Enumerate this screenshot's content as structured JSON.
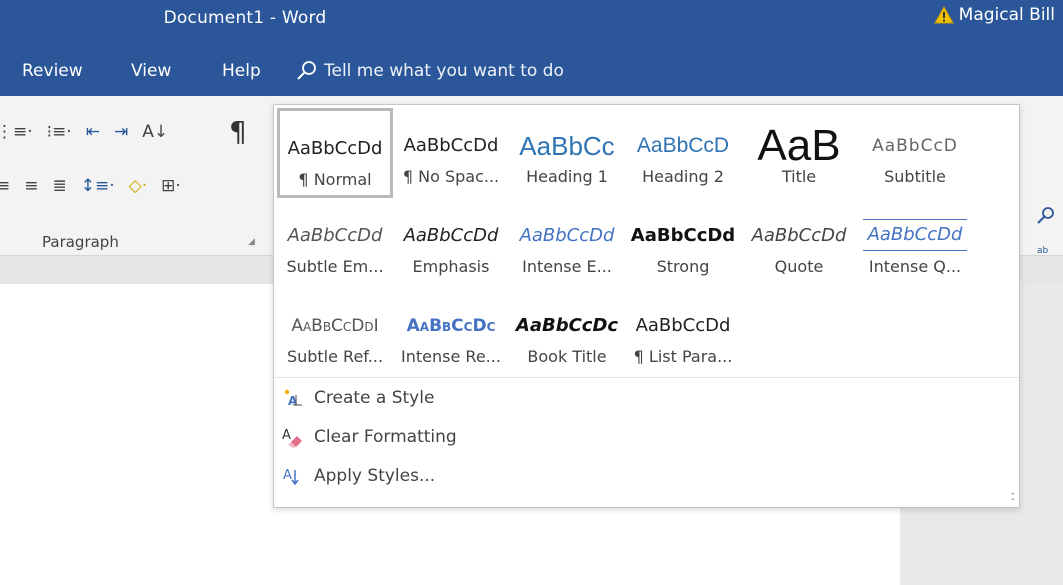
{
  "window": {
    "doc_title": "Document1  -  Word",
    "user_name": "Magical Bill"
  },
  "menu": {
    "tabs": [
      "Review",
      "View",
      "Help"
    ],
    "tell_me": "Tell me what you want to do"
  },
  "ribbon": {
    "paragraph_group_label": "Paragraph"
  },
  "styles": {
    "row1": [
      {
        "preview": "AaBbCcDd",
        "name": "¶ Normal"
      },
      {
        "preview": "AaBbCcDd",
        "name": "¶ No Spac..."
      },
      {
        "preview": "AaBbCc",
        "name": "Heading 1"
      },
      {
        "preview": "AaBbCcD",
        "name": "Heading 2"
      },
      {
        "preview": "AaB",
        "name": "Title"
      },
      {
        "preview": "AaBbCcD",
        "name": "Subtitle"
      }
    ],
    "row2": [
      {
        "preview": "AaBbCcDd",
        "name": "Subtle Em..."
      },
      {
        "preview": "AaBbCcDd",
        "name": "Emphasis"
      },
      {
        "preview": "AaBbCcDd",
        "name": "Intense E..."
      },
      {
        "preview": "AaBbCcDd",
        "name": "Strong"
      },
      {
        "preview": "AaBbCcDd",
        "name": "Quote"
      },
      {
        "preview": "AaBbCcDd",
        "name": "Intense Q..."
      }
    ],
    "row3": [
      {
        "preview": "AaBbCcDdI",
        "name": "Subtle Ref..."
      },
      {
        "preview": "AaBbCcDc",
        "name": "Intense Re..."
      },
      {
        "preview": "AaBbCcDc",
        "name": "Book Title"
      },
      {
        "preview": "AaBbCcDd",
        "name": "¶ List Para..."
      }
    ]
  },
  "actions": {
    "create_style": "Create a Style",
    "clear_formatting": "Clear Formatting",
    "apply_styles": "Apply Styles..."
  },
  "colors": {
    "title_bar": "#2b579a",
    "accent_blue": "#4472c4",
    "warning": "#f2c200"
  },
  "icons": [
    "warning-icon",
    "search-icon",
    "pilcrow-icon",
    "sort-icon",
    "line-spacing-icon",
    "shading-icon",
    "borders-icon",
    "create-style-icon",
    "clear-formatting-icon",
    "apply-styles-icon"
  ]
}
